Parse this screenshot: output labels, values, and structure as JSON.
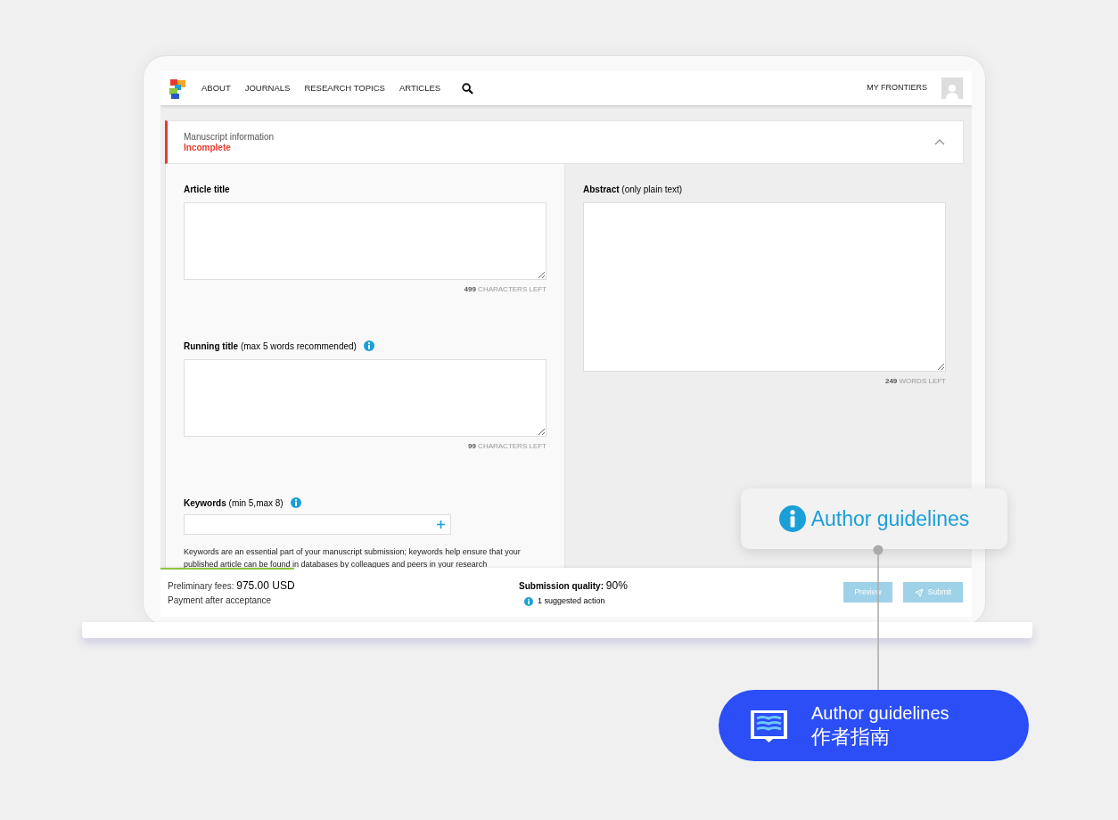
{
  "nav": {
    "items": [
      "ABOUT",
      "JOURNALS",
      "RESEARCH TOPICS",
      "ARTICLES"
    ],
    "right_link": "MY FRONTIERS"
  },
  "section": {
    "title": "Manuscript information",
    "status": "Incomplete",
    "expanded": true
  },
  "left_fields": [
    {
      "kind": "textarea",
      "label": "Article title",
      "info": false,
      "counter_value": "499",
      "counter_text": "CHARACTERS LEFT"
    },
    {
      "kind": "textarea",
      "label": "Running title",
      "hint": "(max 5 words recommended)",
      "info": true,
      "counter_value": "99",
      "counter_text": "CHARACTERS LEFT"
    },
    {
      "kind": "tag_input",
      "label": "Keywords",
      "hint": "(min 5,max 8)",
      "info": true,
      "description": "Keywords are an essential part of your manuscript submission; keywords help ensure that your published article can be found in databases by colleagues and peers in your research"
    }
  ],
  "right_fields": [
    {
      "kind": "textarea",
      "label": "Abstract",
      "hint": "(only plain text)",
      "info": false,
      "counter_value": "249",
      "counter_text": "WORDS LEFT"
    }
  ],
  "footer": {
    "progress": {
      "level": 0.165
    },
    "fees_label": "Preliminary fees:",
    "fees_value": "975.00 USD",
    "payment_note": "Payment after acceptance",
    "quality_label": "Submission quality:",
    "quality_value": "90%",
    "suggestion": "1 suggested action",
    "buttons": [
      {
        "label": "Preview",
        "kind": "plain",
        "disabled": true
      },
      {
        "label": "Submit",
        "kind": "send",
        "disabled": true
      }
    ]
  },
  "callout": {
    "label": "Author guidelines"
  },
  "badge": {
    "title": "Author guidelines",
    "subtitle": "作者指南"
  }
}
